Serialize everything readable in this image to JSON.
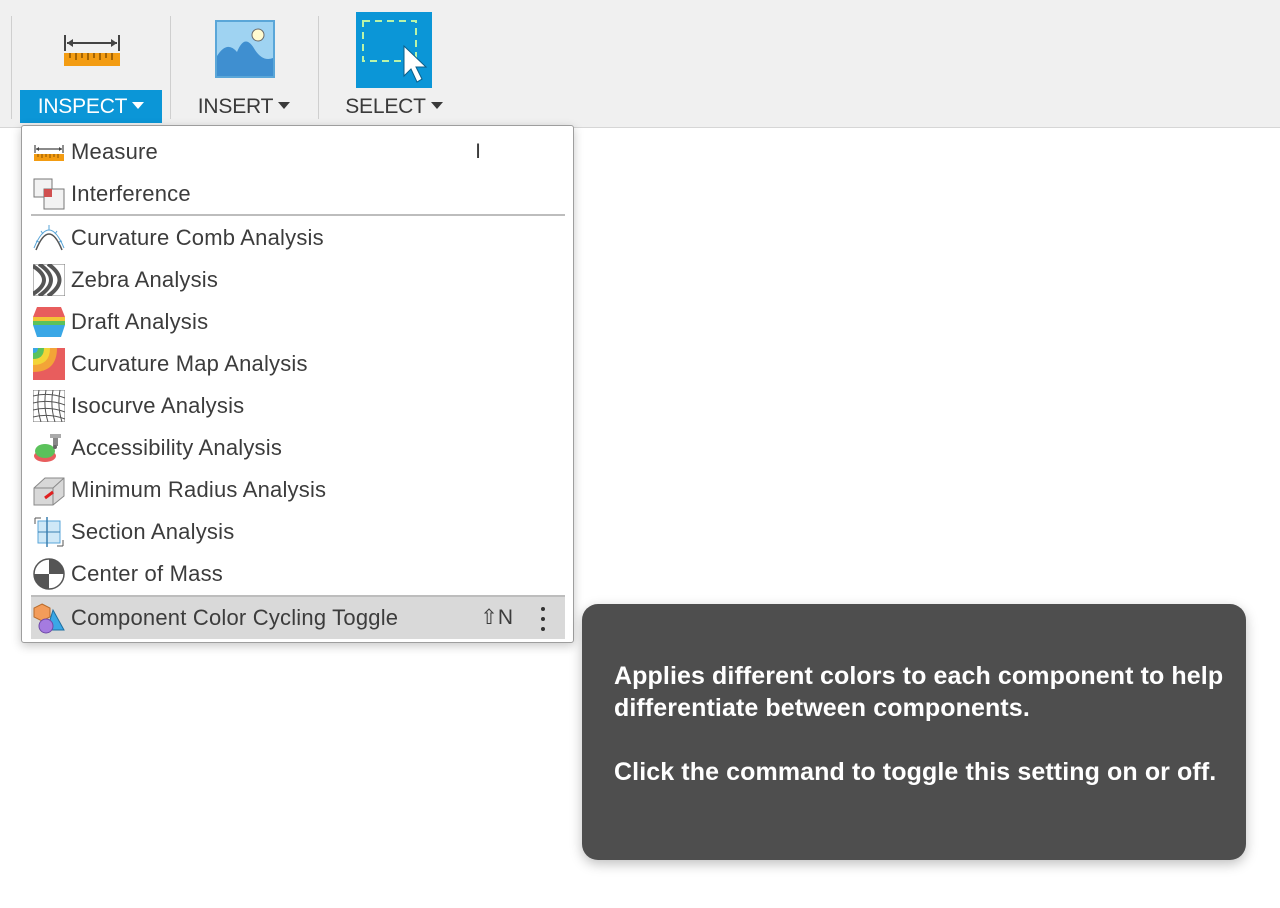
{
  "toolbar": {
    "inspect_label": "INSPECT",
    "insert_label": "INSERT",
    "select_label": "SELECT",
    "accent_color": "#0b96d7"
  },
  "menu": {
    "items": [
      {
        "label": "Measure",
        "icon": "measure-icon",
        "shortcut": "I"
      },
      {
        "label": "Interference",
        "icon": "interference-icon"
      },
      {
        "label": "Curvature Comb Analysis",
        "icon": "curvature-comb-icon"
      },
      {
        "label": "Zebra Analysis",
        "icon": "zebra-icon"
      },
      {
        "label": "Draft Analysis",
        "icon": "draft-icon"
      },
      {
        "label": "Curvature Map Analysis",
        "icon": "curvature-map-icon"
      },
      {
        "label": "Isocurve Analysis",
        "icon": "isocurve-icon"
      },
      {
        "label": "Accessibility Analysis",
        "icon": "accessibility-icon"
      },
      {
        "label": "Minimum Radius Analysis",
        "icon": "minimum-radius-icon"
      },
      {
        "label": "Section Analysis",
        "icon": "section-icon"
      },
      {
        "label": "Center of Mass",
        "icon": "center-of-mass-icon"
      },
      {
        "label": "Component Color Cycling Toggle",
        "icon": "component-color-icon",
        "shortcut": "⇧N",
        "highlighted": true
      }
    ]
  },
  "tooltip": {
    "line1": "Applies different colors to each component to help differentiate between components.",
    "line2": "Click the command to toggle this setting on or off."
  }
}
